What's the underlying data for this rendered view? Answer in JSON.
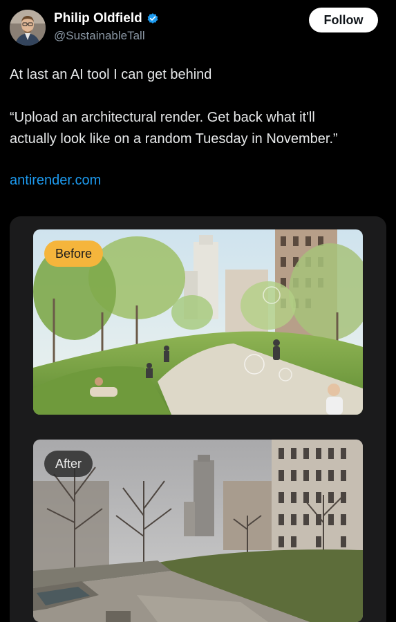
{
  "author": {
    "name": "Philip Oldfield",
    "handle": "@SustainableTall",
    "verified": true,
    "avatar_icon": "avatar-photo"
  },
  "follow_label": "Follow",
  "tweet": {
    "line1": "At last an AI tool I can get behind",
    "line2": "“Upload an architectural render. Get back what it'll",
    "line3": "actually look like on a random Tuesday in November.”",
    "link": "antirender.com"
  },
  "images": {
    "before_label": "Before",
    "after_label": "After"
  },
  "colors": {
    "background": "#000000",
    "link": "#1d9bf0",
    "verified": "#1d9bf0",
    "card": "#1b1b1c",
    "before_badge": "#f5b53c",
    "after_badge": "#2d2d2d"
  }
}
